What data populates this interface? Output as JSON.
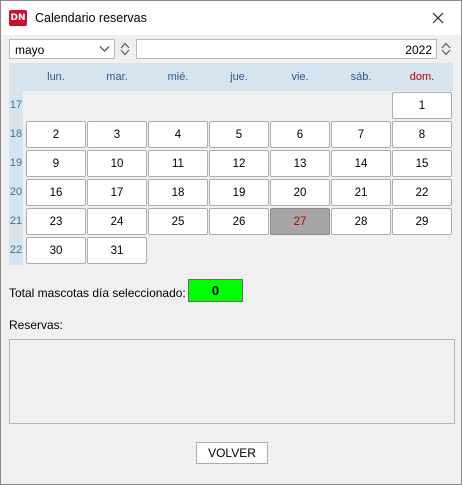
{
  "window": {
    "title": "Calendario reservas",
    "icon_text": "DN"
  },
  "controls": {
    "month": "mayo",
    "year": "2022"
  },
  "calendar": {
    "day_headers": [
      "lun.",
      "mar.",
      "mié.",
      "jue.",
      "vie.",
      "sáb.",
      "dom."
    ],
    "week_numbers": [
      "17",
      "18",
      "19",
      "20",
      "21",
      "22"
    ],
    "weeks": [
      [
        "",
        "",
        "",
        "",
        "",
        "",
        "1"
      ],
      [
        "2",
        "3",
        "4",
        "5",
        "6",
        "7",
        "8"
      ],
      [
        "9",
        "10",
        "11",
        "12",
        "13",
        "14",
        "15"
      ],
      [
        "16",
        "17",
        "18",
        "19",
        "20",
        "21",
        "22"
      ],
      [
        "23",
        "24",
        "25",
        "26",
        "27",
        "28",
        "29"
      ],
      [
        "30",
        "31",
        "",
        "",
        "",
        "",
        ""
      ]
    ],
    "selected_day": "27"
  },
  "total": {
    "label": "Total mascotas día seleccionado:",
    "value": "0"
  },
  "reservas": {
    "label": "Reservas:"
  },
  "buttons": {
    "volver": "VOLVER"
  },
  "colors": {
    "selected_bg": "#a6a6a6",
    "total_bg": "#00ff00",
    "header_bg": "#d5e4ef",
    "sunday": "#c00000"
  }
}
